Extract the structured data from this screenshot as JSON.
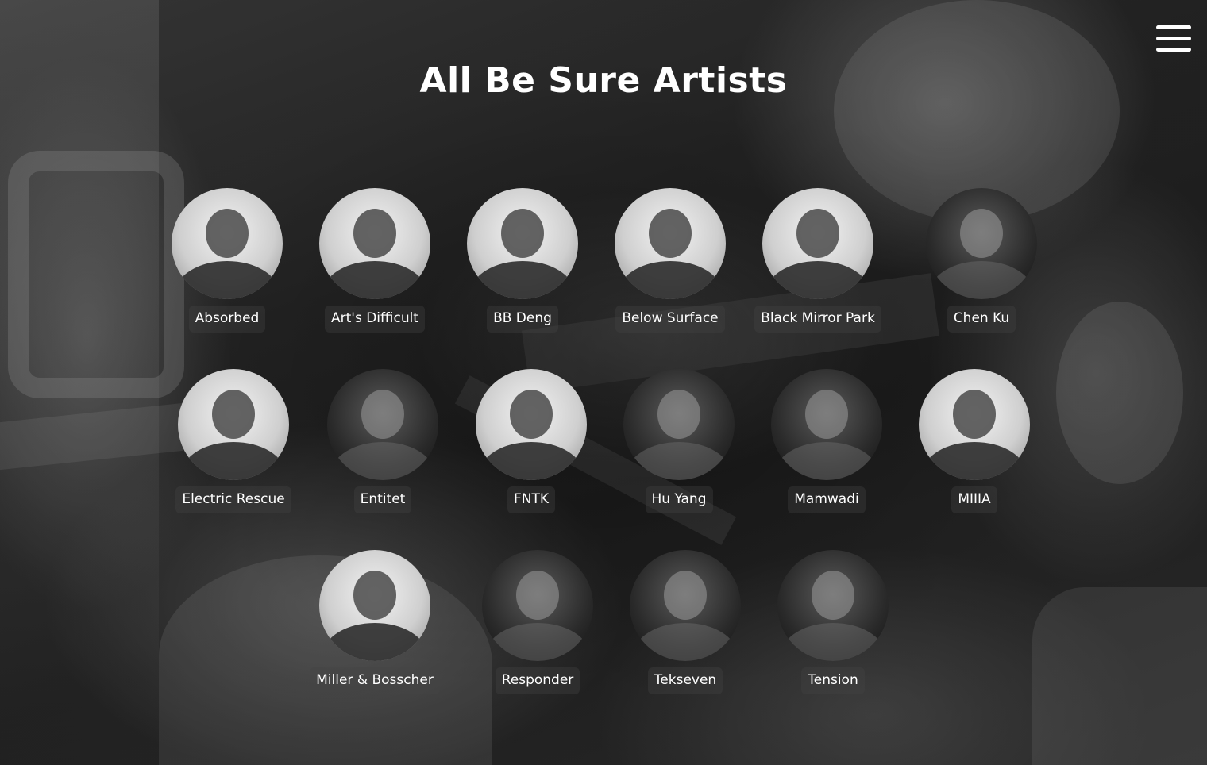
{
  "header": {
    "title": "All Be Sure Artists",
    "menu_icon": "hamburger-menu-icon"
  },
  "artists": [
    {
      "name": "Absorbed",
      "tone": "light"
    },
    {
      "name": "Art's Difficult",
      "tone": "light"
    },
    {
      "name": "BB Deng",
      "tone": "light"
    },
    {
      "name": "Below Surface",
      "tone": "light"
    },
    {
      "name": "Black Mirror Park",
      "tone": "light"
    },
    {
      "name": "Chen Ku",
      "tone": "dark"
    },
    {
      "name": "Electric Rescue",
      "tone": "light"
    },
    {
      "name": "Entitet",
      "tone": "dark"
    },
    {
      "name": "FNTK",
      "tone": "light"
    },
    {
      "name": "Hu Yang",
      "tone": "dark"
    },
    {
      "name": "Mamwadi",
      "tone": "dark"
    },
    {
      "name": "MIIIA",
      "tone": "light"
    },
    {
      "name": "Miller & Bosscher",
      "tone": "light"
    },
    {
      "name": "Responder",
      "tone": "dark"
    },
    {
      "name": "Tekseven",
      "tone": "dark"
    },
    {
      "name": "Tension",
      "tone": "dark"
    }
  ]
}
